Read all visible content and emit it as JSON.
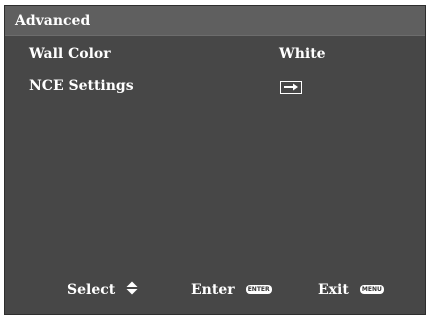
{
  "menu": {
    "title": "Advanced",
    "items": [
      {
        "label": "Wall Color",
        "value": "White"
      },
      {
        "label": "NCE Settings",
        "value_icon": "enter-arrow-icon"
      }
    ]
  },
  "footer": {
    "select_label": "Select",
    "select_icon": "up-down-arrows-icon",
    "enter_label": "Enter",
    "enter_key": "ENTER",
    "exit_label": "Exit",
    "exit_key": "MENU"
  },
  "colors": {
    "panel_background": "#474747",
    "title_background": "#5f5f5f",
    "text": "#ffffff"
  }
}
